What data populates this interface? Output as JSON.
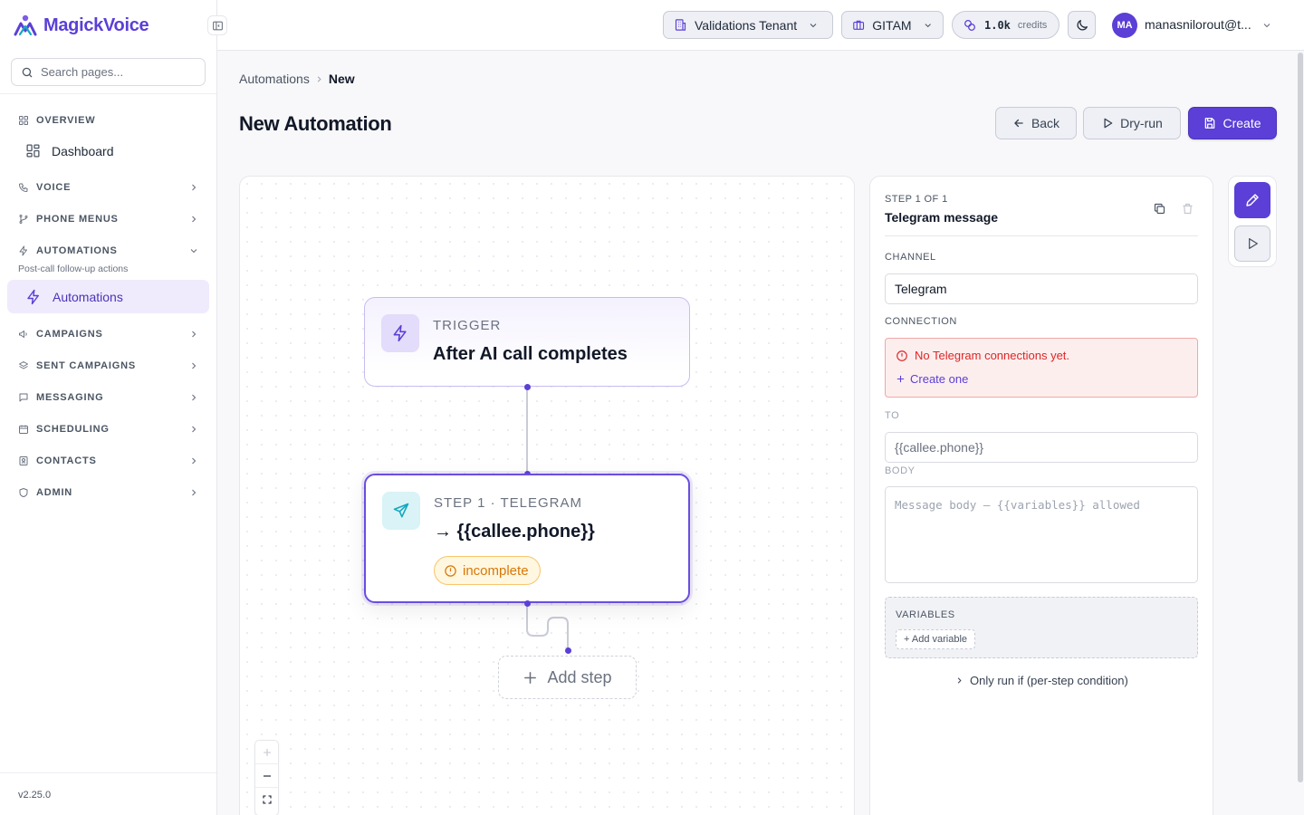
{
  "app": {
    "name": "MagickVoice",
    "version": "v2.25.0"
  },
  "sidebar": {
    "search_placeholder": "Search pages...",
    "overview": {
      "label": "OVERVIEW",
      "items": [
        {
          "label": "Dashboard"
        }
      ]
    },
    "groups": [
      {
        "label": "VOICE"
      },
      {
        "label": "PHONE MENUS"
      },
      {
        "label": "AUTOMATIONS",
        "note": "Post-call follow-up actions",
        "items": [
          {
            "label": "Automations",
            "active": true
          }
        ]
      },
      {
        "label": "CAMPAIGNS"
      },
      {
        "label": "SENT CAMPAIGNS"
      },
      {
        "label": "MESSAGING"
      },
      {
        "label": "SCHEDULING"
      },
      {
        "label": "CONTACTS"
      },
      {
        "label": "ADMIN"
      }
    ]
  },
  "topbar": {
    "tenant": "Validations Tenant",
    "org": "GITAM",
    "credits_value": "1.0k",
    "credits_label": "credits",
    "user_initials": "MA",
    "user_email": "manasnilorout@t..."
  },
  "header": {
    "breadcrumb": [
      "Automations",
      "New"
    ],
    "title": "New Automation",
    "back_label": "Back",
    "dryrun_label": "Dry-run",
    "create_label": "Create"
  },
  "canvas": {
    "trigger": {
      "kicker": "TRIGGER",
      "title": "After AI call completes"
    },
    "step": {
      "kicker": "STEP 1 · TELEGRAM",
      "title": "→ {{callee.phone}}",
      "status": "incomplete"
    },
    "add_step_label": "Add step"
  },
  "panel": {
    "step_count": "STEP 1 OF 1",
    "step_name": "Telegram message",
    "channel_label": "CHANNEL",
    "channel_value": "Telegram",
    "connection_label": "CONNECTION",
    "alert_message": "No Telegram connections yet.",
    "alert_link": "Create one",
    "to_label": "TO",
    "to_placeholder": "{{callee.phone}}",
    "body_label": "BODY",
    "body_placeholder": "Message body — {{variables}} allowed",
    "variables_label": "VARIABLES",
    "add_variable_label": "+ Add variable",
    "condition_label": "Only run if (per-step condition)"
  },
  "colors": {
    "accent": "#5b3fd6",
    "danger": "#dc2626",
    "warning": "#d97706",
    "telegram": "#14a7c1"
  }
}
